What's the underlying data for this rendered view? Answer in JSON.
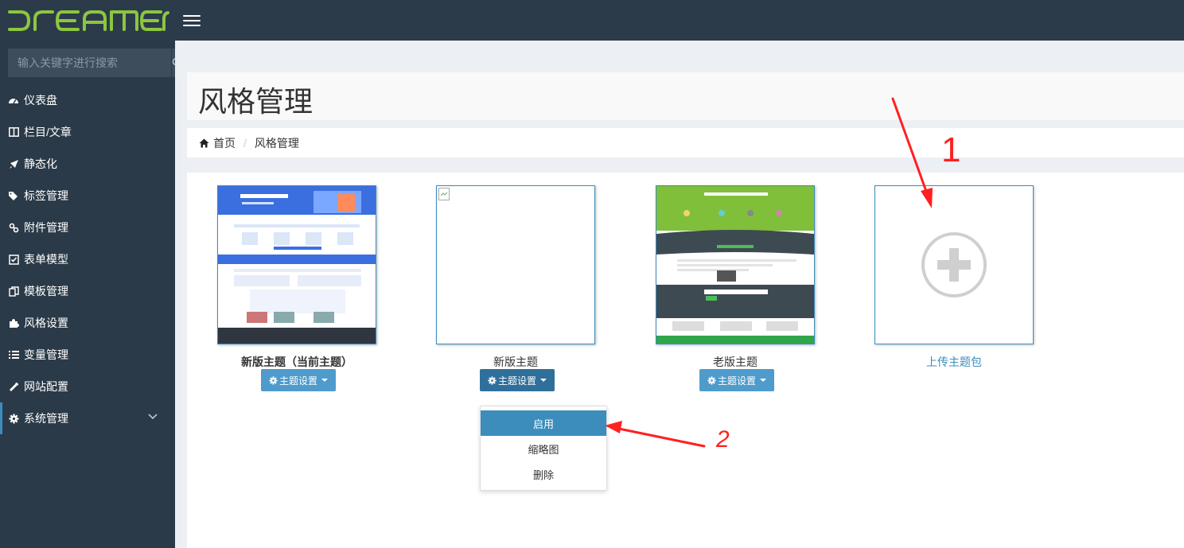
{
  "brand": {
    "logo_text": "DREAMER",
    "logo_color": "#8cc63f"
  },
  "sidebar": {
    "search_placeholder": "输入关键字进行搜索",
    "items": [
      {
        "label": "仪表盘",
        "icon": "dashboard-icon"
      },
      {
        "label": "栏目/文章",
        "icon": "columns-icon"
      },
      {
        "label": "静态化",
        "icon": "rocket-icon"
      },
      {
        "label": "标签管理",
        "icon": "tags-icon"
      },
      {
        "label": "附件管理",
        "icon": "paperclip-icon"
      },
      {
        "label": "表单模型",
        "icon": "check-square-icon"
      },
      {
        "label": "模板管理",
        "icon": "copy-icon"
      },
      {
        "label": "风格设置",
        "icon": "puzzle-icon"
      },
      {
        "label": "变量管理",
        "icon": "list-icon"
      },
      {
        "label": "网站配置",
        "icon": "wrench-icon"
      },
      {
        "label": "系统管理",
        "icon": "gear-icon"
      }
    ]
  },
  "page": {
    "title": "风格管理"
  },
  "breadcrumb": {
    "home": "首页",
    "current": "风格管理"
  },
  "themes": [
    {
      "name": "新版主题（当前主题）",
      "button": "主题设置"
    },
    {
      "name": "新版主题",
      "button": "主题设置"
    },
    {
      "name": "老版主题",
      "button": "主题设置"
    },
    {
      "name": "上传主题包"
    }
  ],
  "dropdown": {
    "items": [
      "启用",
      "缩略图",
      "删除"
    ]
  },
  "annotations": {
    "mark1": "1",
    "mark2": "2"
  },
  "colors": {
    "topbar": "#2c3b4a",
    "sidebar": "#2b3a48",
    "accent": "#3c8dbc",
    "button": "#4e9bcc",
    "annotation": "#ff2020"
  }
}
